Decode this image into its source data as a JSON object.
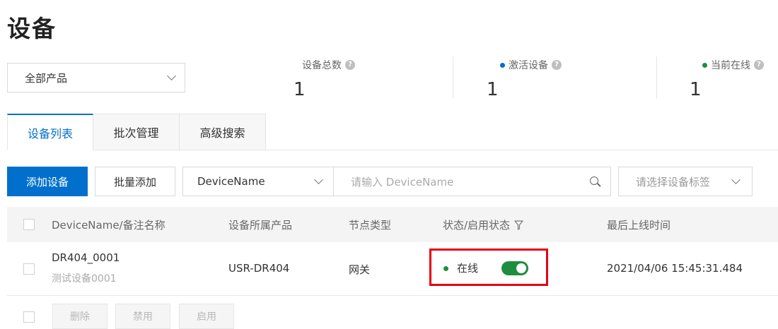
{
  "page": {
    "title": "设备"
  },
  "filters": {
    "product_select": "全部产品"
  },
  "stats": [
    {
      "label": "设备总数",
      "value": "1",
      "dot_color": null
    },
    {
      "label": "激活设备",
      "value": "1",
      "dot_color": "#0070cc"
    },
    {
      "label": "当前在线",
      "value": "1",
      "dot_color": "#1e8e3e"
    }
  ],
  "tabs": [
    "设备列表",
    "批次管理",
    "高级搜索"
  ],
  "toolbar": {
    "add_label": "添加设备",
    "batch_add_label": "批量添加",
    "field_select": "DeviceName",
    "search_placeholder": "请输入 DeviceName",
    "tag_placeholder": "请选择设备标签"
  },
  "table": {
    "columns": [
      "DeviceName/备注名称",
      "设备所属产品",
      "节点类型",
      "状态/启用状态",
      "最后上线时间"
    ],
    "rows": [
      {
        "name": "DR404_0001",
        "remark": "测试设备0001",
        "product": "USR-DR404",
        "node_type": "网关",
        "status": "在线",
        "enabled": true,
        "last_online": "2021/04/06 15:45:31.484"
      }
    ]
  },
  "footer": {
    "delete_label": "删除",
    "disable_label": "禁用",
    "enable_label": "启用"
  },
  "colors": {
    "primary": "#0070cc",
    "online": "#1e8e3e",
    "highlight": "#e60012"
  }
}
